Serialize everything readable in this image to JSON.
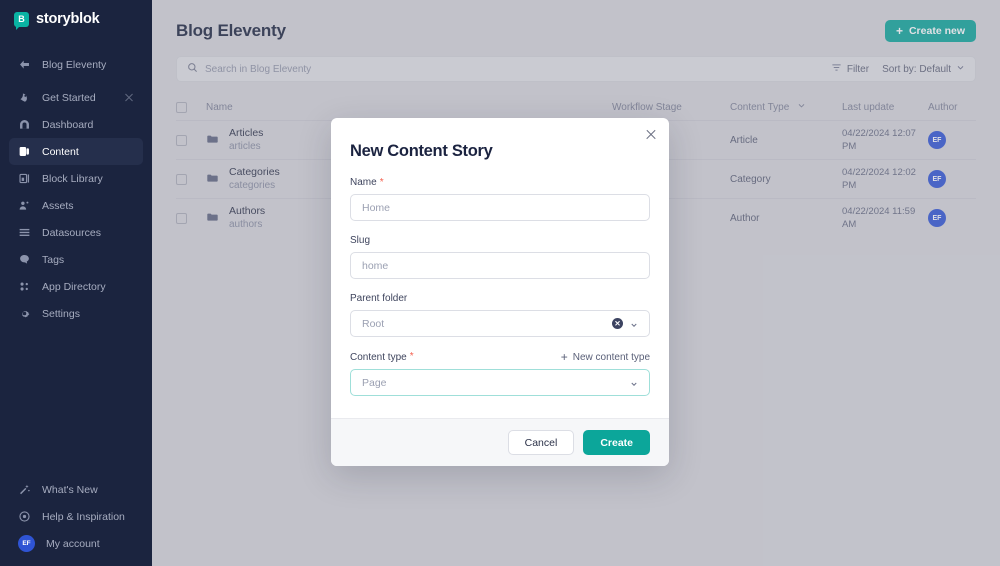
{
  "sidebar": {
    "brand": {
      "mark": "B",
      "name": "storyblok"
    },
    "back": {
      "label": "Blog Eleventy",
      "icon": "arrow-left-icon"
    },
    "items": [
      {
        "label": "Get Started",
        "icon": "rocket-icon",
        "active": false,
        "closable": true
      },
      {
        "label": "Dashboard",
        "icon": "dashboard-icon",
        "active": false
      },
      {
        "label": "Content",
        "icon": "content-icon",
        "active": true
      },
      {
        "label": "Block Library",
        "icon": "block-library-icon",
        "active": false
      },
      {
        "label": "Assets",
        "icon": "assets-icon",
        "active": false
      },
      {
        "label": "Datasources",
        "icon": "datasources-icon",
        "active": false
      },
      {
        "label": "Tags",
        "icon": "tags-icon",
        "active": false
      },
      {
        "label": "App Directory",
        "icon": "app-directory-icon",
        "active": false
      },
      {
        "label": "Settings",
        "icon": "gear-icon",
        "active": false
      }
    ],
    "bottom": [
      {
        "label": "What's New",
        "icon": "sparkles-icon"
      },
      {
        "label": "Help & Inspiration",
        "icon": "help-icon"
      },
      {
        "label": "My account",
        "icon": "avatar",
        "avatar": "EF"
      }
    ]
  },
  "header": {
    "title": "Blog Eleventy",
    "create_new_label": "Create new",
    "create_new_icon": "plus-icon",
    "accent_color": "#0ca69a"
  },
  "toolbar": {
    "search_placeholder": "Search in Blog Eleventy",
    "search_value": "",
    "search_icon": "search-icon",
    "filter_label": "Filter",
    "filter_icon": "filter-icon",
    "sort_label": "Sort by: Default",
    "sort_icon": "chevron-down-icon"
  },
  "table": {
    "columns": {
      "name": "Name",
      "workflow_stage": "Workflow Stage",
      "content_type": "Content Type",
      "last_update": "Last update",
      "author": "Author"
    },
    "rows": [
      {
        "name": "Articles",
        "slug": "articles",
        "workflow_stage": "",
        "content_type": "Article",
        "last_update": "04/22/2024 12:07 PM",
        "author": "EF"
      },
      {
        "name": "Categories",
        "slug": "categories",
        "workflow_stage": "",
        "content_type": "Category",
        "last_update": "04/22/2024 12:02 PM",
        "author": "EF"
      },
      {
        "name": "Authors",
        "slug": "authors",
        "workflow_stage": "",
        "content_type": "Author",
        "last_update": "04/22/2024 11:59 AM",
        "author": "EF"
      }
    ]
  },
  "modal": {
    "title": "New Content Story",
    "close_icon": "close-icon",
    "name_field": {
      "label": "Name",
      "required": "*",
      "value": "",
      "placeholder": "Home"
    },
    "slug_field": {
      "label": "Slug",
      "value": "",
      "placeholder": "home"
    },
    "parent_folder_field": {
      "label": "Parent folder",
      "value": "Root",
      "clear_icon": "clear-circle-icon",
      "chevron_icon": "chevron-down-icon"
    },
    "content_type_field": {
      "label": "Content type",
      "required": "*",
      "new_link_label": "New content type",
      "new_link_icon": "plus-icon",
      "value": "Page",
      "chevron_icon": "chevron-down-icon",
      "focus_border_color": "#9fdfd9"
    },
    "cancel_label": "Cancel",
    "create_label": "Create"
  }
}
